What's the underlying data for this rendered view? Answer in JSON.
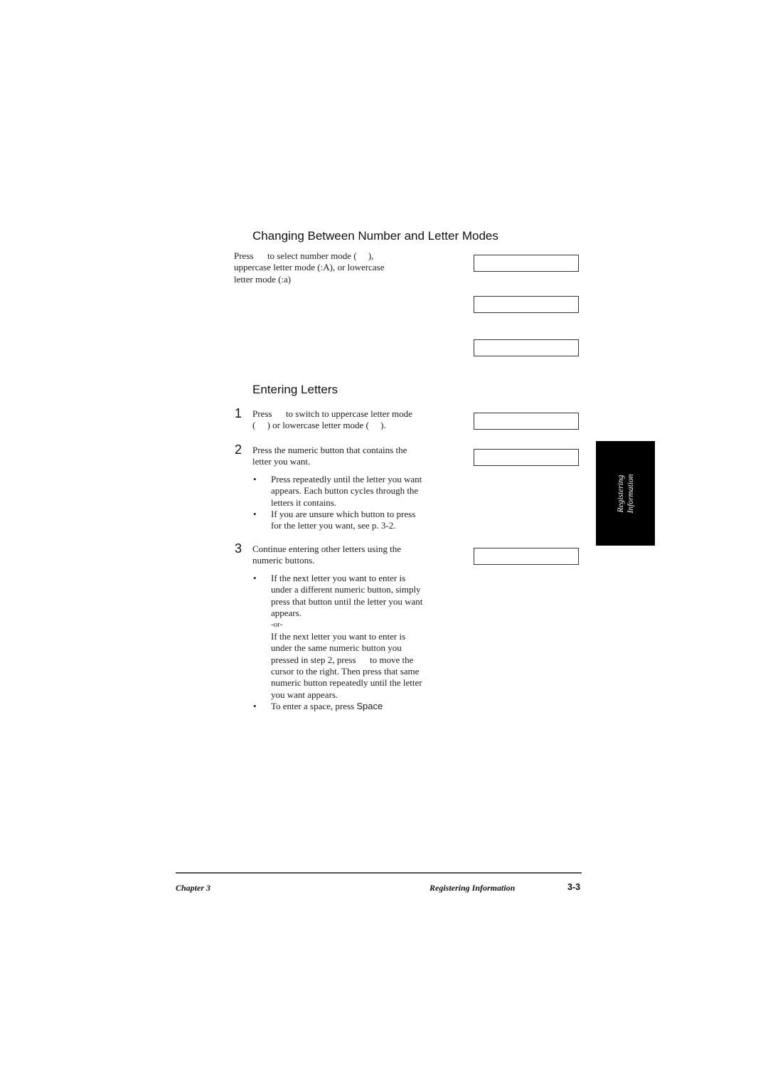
{
  "section1": {
    "heading": "Changing Between Number and Letter Modes",
    "lines": [
      "Press      to select number mode (     ),",
      "uppercase letter mode (:A), or lowercase",
      "letter mode (:a)"
    ]
  },
  "section2": {
    "heading": "Entering Letters",
    "steps": [
      {
        "number": "1",
        "lines": [
          "Press      to switch to uppercase letter mode",
          "(     ) or lowercase letter mode (     )."
        ]
      },
      {
        "number": "2",
        "lines": [
          "Press the numeric button that contains the",
          "letter you want."
        ],
        "bullets": [
          {
            "lines": [
              "Press repeatedly until the letter you want",
              "appears. Each button cycles through the",
              "letters it contains."
            ]
          },
          {
            "lines": [
              "If you are unsure which button to press",
              "for the letter you want, see p. 3-2."
            ]
          }
        ]
      },
      {
        "number": "3",
        "lines": [
          "Continue entering other letters using the",
          "numeric buttons."
        ],
        "bullets": [
          {
            "lines": [
              "If the next letter you want to enter is",
              "under a different numeric button, simply",
              "press that button until the letter you want",
              "appears.",
              "-or-",
              "If the next letter you want to enter is",
              "under the same numeric button you",
              "pressed in step 2, press      to move the",
              "cursor to the right. Then press that same",
              "numeric button repeatedly until the letter",
              "you want appears."
            ]
          },
          {
            "prefix": "To enter a space, press ",
            "key": "Space"
          }
        ]
      }
    ]
  },
  "side_tab": {
    "line1": "Registering",
    "line2": "Information"
  },
  "footer": {
    "chapter": "Chapter 3",
    "section": "Registering Information",
    "page": "3-3"
  },
  "bullet_char": "•"
}
